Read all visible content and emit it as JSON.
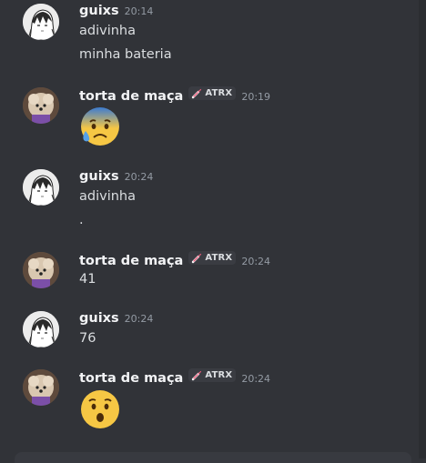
{
  "messages": [
    {
      "author": "guixs",
      "time": "20:14",
      "lines": [
        "adivinha",
        "minha bateria"
      ]
    },
    {
      "author": "torta de maça",
      "clan_tag": "ATRX",
      "time": "20:19",
      "emoji": "anxious-face-with-sweat"
    },
    {
      "author": "guixs",
      "time": "20:24",
      "lines": [
        "adivinha",
        "."
      ]
    },
    {
      "author": "torta de maça",
      "clan_tag": "ATRX",
      "time": "20:24",
      "lines": [
        "41"
      ]
    },
    {
      "author": "guixs",
      "time": "20:24",
      "lines": [
        "76"
      ]
    },
    {
      "author": "torta de maça",
      "clan_tag": "ATRX",
      "time": "20:24",
      "emoji": "hushed-face"
    }
  ],
  "colors": {
    "background": "#313338",
    "username": "#f2f3f5",
    "text": "#dbdee1",
    "timestamp": "#949ba4",
    "tag_bg": "#3a3c42",
    "tag_icon": "#ea5a7a"
  },
  "icons": {
    "anime-avatar": "guixs-avatar",
    "dog-avatar": "torta-avatar",
    "clan-badge": "syringe-icon"
  }
}
